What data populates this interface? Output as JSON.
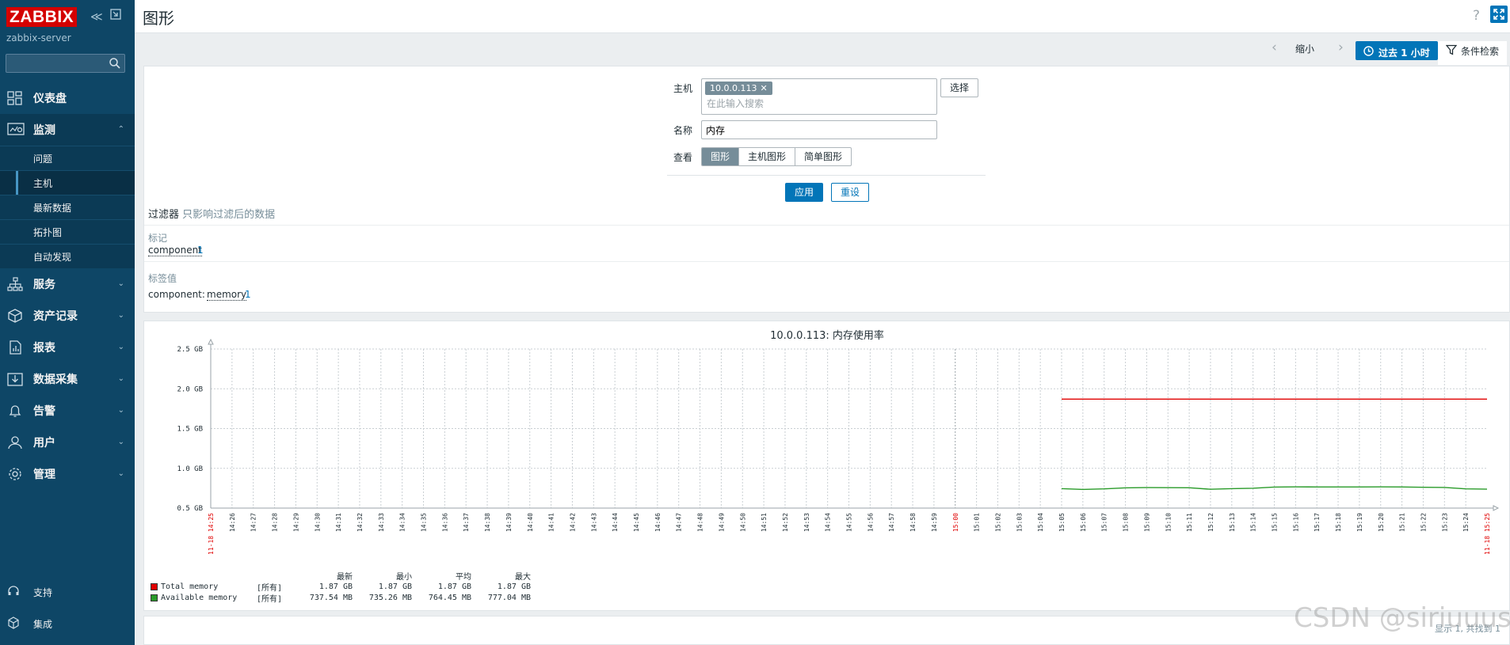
{
  "brand": {
    "logo": "ZABBIX",
    "server": "zabbix-server"
  },
  "sidebar": {
    "search_placeholder": "",
    "items": [
      {
        "label": "仪表盘",
        "icon": "dashboard-icon",
        "open": false
      },
      {
        "label": "监测",
        "icon": "monitoring-icon",
        "open": true,
        "children": [
          {
            "label": "问题"
          },
          {
            "label": "主机",
            "active": true
          },
          {
            "label": "最新数据"
          },
          {
            "label": "拓扑图"
          },
          {
            "label": "自动发现"
          }
        ]
      },
      {
        "label": "服务",
        "icon": "services-icon"
      },
      {
        "label": "资产记录",
        "icon": "inventory-icon"
      },
      {
        "label": "报表",
        "icon": "reports-icon"
      },
      {
        "label": "数据采集",
        "icon": "data-collection-icon"
      },
      {
        "label": "告警",
        "icon": "alerts-icon"
      },
      {
        "label": "用户",
        "icon": "users-icon"
      },
      {
        "label": "管理",
        "icon": "administration-icon"
      }
    ],
    "bottom": [
      {
        "label": "支持",
        "icon": "support-icon"
      },
      {
        "label": "集成",
        "icon": "integrations-icon"
      }
    ]
  },
  "header": {
    "title": "图形",
    "help": "?"
  },
  "timebar": {
    "zoom_out": "缩小",
    "period": "过去 1 小时",
    "filter": "条件检索"
  },
  "filter": {
    "host_label": "主机",
    "host_value": "10.0.0.113",
    "host_placeholder": "在此输入搜索",
    "select_button": "选择",
    "name_label": "名称",
    "name_value": "内存",
    "view_label": "查看",
    "view_options": [
      "图形",
      "主机图形",
      "简单图形"
    ],
    "view_selected": "图形",
    "apply": "应用",
    "reset": "重设",
    "subfilter_title": "过滤器",
    "subfilter_hint": "只影响过滤后的数据",
    "tags_label": "标记",
    "tag_name": "component",
    "tag_count": "1",
    "tag_values_label": "标签值",
    "tag_key": "component:",
    "tag_value": "memory",
    "tag_value_count": "1"
  },
  "chart_data": {
    "type": "line",
    "title": "10.0.0.113: 内存使用率",
    "y_tick_labels": [
      "0.5 GB",
      "1.0 GB",
      "1.5 GB",
      "2.0 GB",
      "2.5 GB"
    ],
    "ylim": [
      0.5,
      2.5
    ],
    "y_unit": "GB",
    "x_start_label": "11-18 14:25",
    "x_end_label": "11-18 15:25",
    "x_ticks": [
      "14:26",
      "14:27",
      "14:28",
      "14:29",
      "14:30",
      "14:31",
      "14:32",
      "14:33",
      "14:34",
      "14:35",
      "14:36",
      "14:37",
      "14:38",
      "14:39",
      "14:40",
      "14:41",
      "14:42",
      "14:43",
      "14:44",
      "14:45",
      "14:46",
      "14:47",
      "14:48",
      "14:49",
      "14:50",
      "14:51",
      "14:52",
      "14:53",
      "14:54",
      "14:55",
      "14:56",
      "14:57",
      "14:58",
      "14:59",
      "15:00",
      "15:01",
      "15:02",
      "15:03",
      "15:04",
      "15:05",
      "15:06",
      "15:07",
      "15:08",
      "15:09",
      "15:10",
      "15:11",
      "15:12",
      "15:13",
      "15:14",
      "15:15",
      "15:16",
      "15:17",
      "15:18",
      "15:19",
      "15:20",
      "15:21",
      "15:22",
      "15:23",
      "15:24"
    ],
    "grid": true,
    "series": [
      {
        "name": "Total memory",
        "color": "#e00000",
        "x": [
          "15:05",
          "15:25"
        ],
        "y": [
          1.87,
          1.87
        ]
      },
      {
        "name": "Available memory",
        "color": "#2a9b2a",
        "x": [
          "15:05",
          "15:06",
          "15:07",
          "15:08",
          "15:09",
          "15:10",
          "15:11",
          "15:12",
          "15:13",
          "15:14",
          "15:15",
          "15:16",
          "15:17",
          "15:18",
          "15:19",
          "15:20",
          "15:21",
          "15:22",
          "15:23",
          "15:24",
          "15:25"
        ],
        "y": [
          0.745,
          0.735,
          0.742,
          0.755,
          0.758,
          0.757,
          0.756,
          0.737,
          0.745,
          0.75,
          0.765,
          0.767,
          0.766,
          0.766,
          0.766,
          0.767,
          0.766,
          0.762,
          0.76,
          0.742,
          0.738
        ]
      }
    ]
  },
  "legend": {
    "headers": [
      "最新",
      "最小",
      "平均",
      "最大"
    ],
    "rows": [
      {
        "name": "Total memory",
        "color": "#e00000",
        "scope": "[所有]",
        "last": "1.87 GB",
        "min": "1.87 GB",
        "avg": "1.87 GB",
        "max": "1.87 GB"
      },
      {
        "name": "Available memory",
        "color": "#2a9b2a",
        "scope": "[所有]",
        "last": "737.54 MB",
        "min": "735.26 MB",
        "avg": "764.45 MB",
        "max": "777.04 MB"
      }
    ]
  },
  "footer": {
    "found": "显示 1, 共找到 1"
  },
  "watermark": "CSDN @siriuuus"
}
